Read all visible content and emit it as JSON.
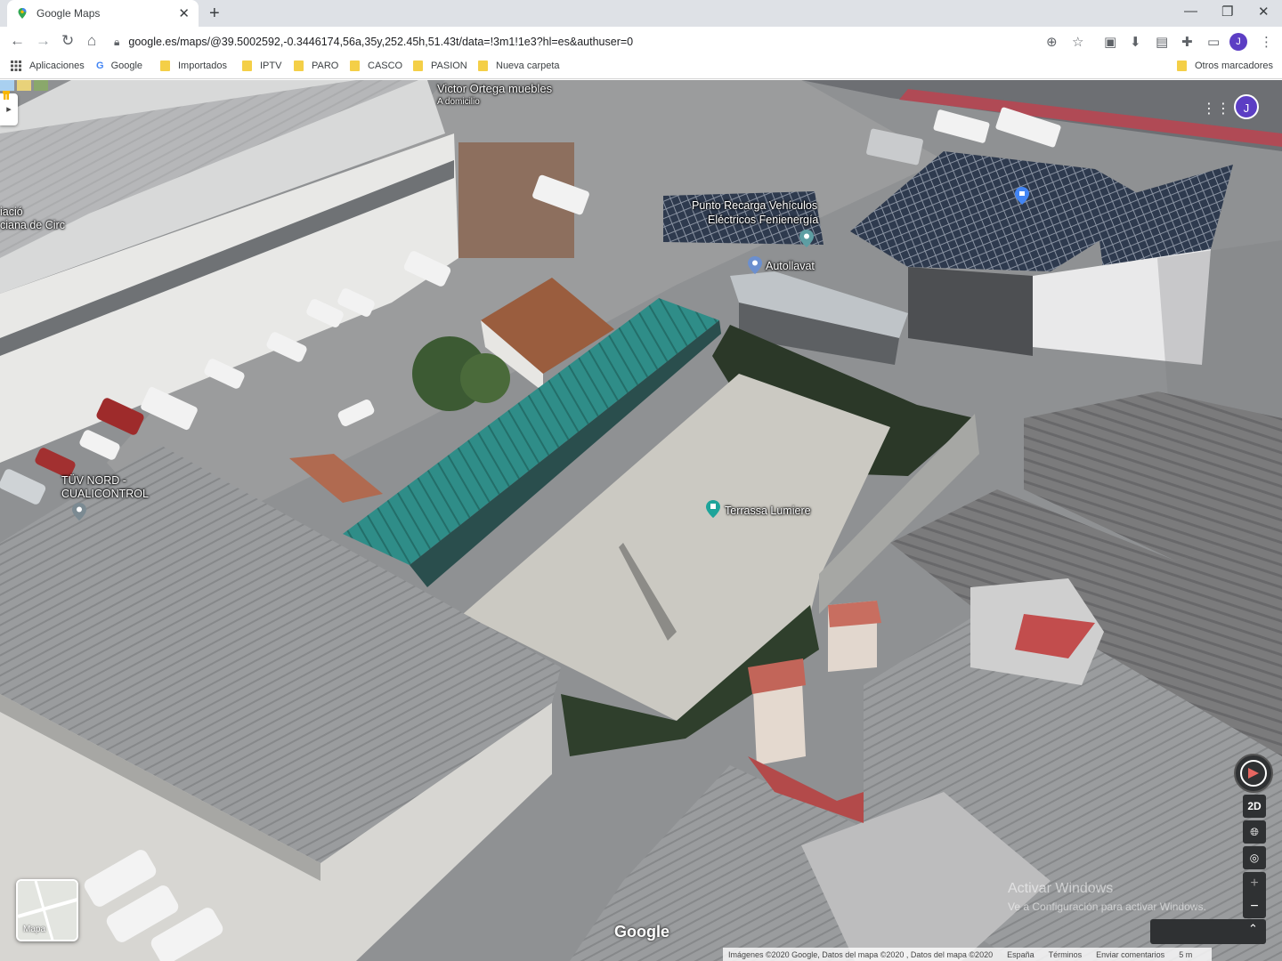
{
  "browser": {
    "tab_title": "Google Maps",
    "new_tab": "+",
    "tab_close": "✕",
    "url": "google.es/maps/@39.5002592,-0.3446174,56a,35y,252.45h,51.43t/data=!3m1!1e3?hl=es&authuser=0",
    "profile_initial": "J"
  },
  "bookmarks": {
    "apps": "Aplicaciones",
    "google": "Google",
    "items": [
      "Importados",
      "IPTV",
      "PARO",
      "CASCO",
      "PASION",
      "Nueva carpeta"
    ],
    "other": "Otros marcadores"
  },
  "map": {
    "labels": {
      "victor_title": "Victor Ortega muebles",
      "victor_sub": "A domicilio",
      "punto_line1": "Punto Recarga Vehículos",
      "punto_line2": "Eléctricos Fenienergía",
      "autollavat": "Autollavat",
      "tuv_line1": "TÜV NORD -",
      "tuv_line2": "CUALICONTROL",
      "terrassa": "Terrassa Lumiere",
      "partial_line1": "iació",
      "partial_line2": "ciana de Circ"
    },
    "controls": {
      "mode_2d": "2D",
      "zoom_in": "+",
      "zoom_out": "−",
      "mapa_label": "Mapa"
    },
    "logo": "Google",
    "watermark_line1": "Activar Windows",
    "watermark_line2": "Ve a Configuración para activar Windows.",
    "attribution": {
      "imagery": "Imágenes ©2020 Google, Datos del mapa ©2020 , Datos del mapa ©2020",
      "country": "España",
      "terms": "Términos",
      "feedback": "Enviar comentarios",
      "scale": "5 m"
    },
    "account_initial": "J"
  }
}
